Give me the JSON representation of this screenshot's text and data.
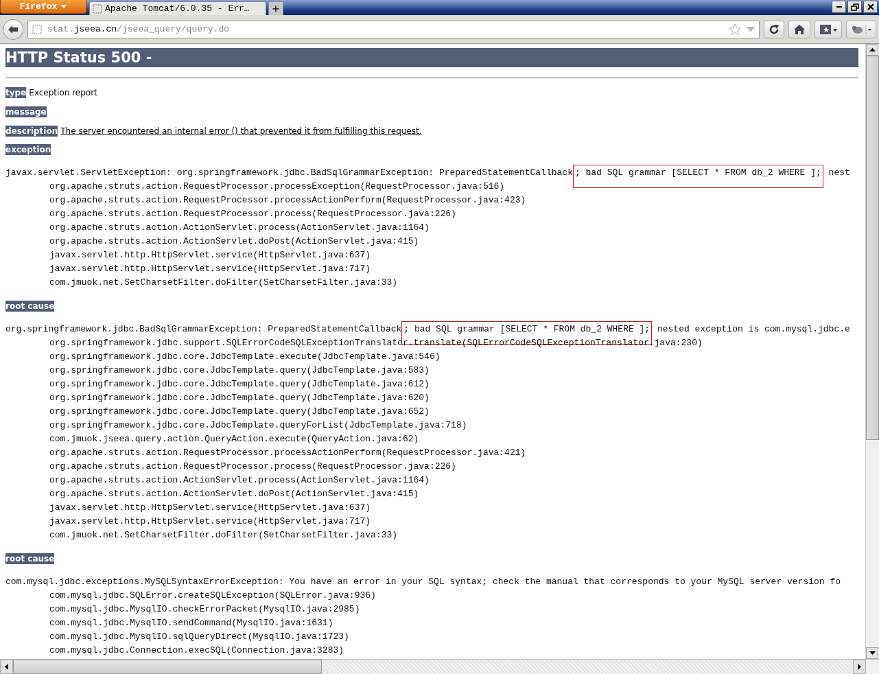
{
  "browser": {
    "menu_button": "Firefox",
    "tabs": [
      {
        "title": "Apache Tomcat/6.0.35 - Err…",
        "selected": true
      }
    ],
    "new_tab": "+",
    "url": {
      "prefix": "stat.",
      "domain": "jseea.cn",
      "path": "/jseea_query/query.do"
    }
  },
  "page": {
    "heading": "HTTP Status 500 -",
    "fields": [
      {
        "label": "type",
        "value": "Exception report",
        "kind": "plain"
      },
      {
        "label": "message"
      },
      {
        "label": "description",
        "value": "The server encountered an internal error () that prevented it from fulfilling this request.",
        "kind": "underlined"
      }
    ],
    "sections": [
      {
        "label": "exception",
        "lines": [
          {
            "kind": "head",
            "segments": [
              {
                "text": "javax.servlet.ServletException: org.springframework.jdbc.BadSqlGrammarException: PreparedStatementCallback",
                "boxed": false
              },
              {
                "text": "; bad SQL grammar [SELECT * FROM db_2 WHERE ];",
                "boxed": true
              },
              {
                "text": " nest",
                "boxed": false
              }
            ]
          },
          {
            "kind": "frame",
            "text": "org.apache.struts.action.RequestProcessor.processException(RequestProcessor.java:516)"
          },
          {
            "kind": "frame",
            "text": "org.apache.struts.action.RequestProcessor.processActionPerform(RequestProcessor.java:423)"
          },
          {
            "kind": "frame",
            "text": "org.apache.struts.action.RequestProcessor.process(RequestProcessor.java:226)"
          },
          {
            "kind": "frame",
            "text": "org.apache.struts.action.ActionServlet.process(ActionServlet.java:1164)"
          },
          {
            "kind": "frame",
            "text": "org.apache.struts.action.ActionServlet.doPost(ActionServlet.java:415)"
          },
          {
            "kind": "frame",
            "text": "javax.servlet.http.HttpServlet.service(HttpServlet.java:637)"
          },
          {
            "kind": "frame",
            "text": "javax.servlet.http.HttpServlet.service(HttpServlet.java:717)"
          },
          {
            "kind": "frame",
            "text": "com.jmuok.net.SetCharsetFilter.doFilter(SetCharsetFilter.java:33)"
          }
        ]
      },
      {
        "label": "root cause",
        "lines": [
          {
            "kind": "head",
            "segments": [
              {
                "text": "org.springframework.jdbc.BadSqlGrammarException: PreparedStatementCallback",
                "boxed": false
              },
              {
                "text": "; bad SQL grammar [SELECT * FROM db_2 WHERE ];",
                "boxed": true
              },
              {
                "text": " nested exception is com.mysql.jdbc.e",
                "boxed": false
              }
            ]
          },
          {
            "kind": "frame",
            "text": "org.springframework.jdbc.support.SQLErrorCodeSQLExceptionTranslator.translate(SQLErrorCodeSQLExceptionTranslator.java:230)"
          },
          {
            "kind": "frame",
            "text": "org.springframework.jdbc.core.JdbcTemplate.execute(JdbcTemplate.java:546)"
          },
          {
            "kind": "frame",
            "text": "org.springframework.jdbc.core.JdbcTemplate.query(JdbcTemplate.java:583)"
          },
          {
            "kind": "frame",
            "text": "org.springframework.jdbc.core.JdbcTemplate.query(JdbcTemplate.java:612)"
          },
          {
            "kind": "frame",
            "text": "org.springframework.jdbc.core.JdbcTemplate.query(JdbcTemplate.java:620)"
          },
          {
            "kind": "frame",
            "text": "org.springframework.jdbc.core.JdbcTemplate.query(JdbcTemplate.java:652)"
          },
          {
            "kind": "frame",
            "text": "org.springframework.jdbc.core.JdbcTemplate.queryForList(JdbcTemplate.java:718)"
          },
          {
            "kind": "frame",
            "text": "com.jmuok.jseea.query.action.QueryAction.execute(QueryAction.java:62)"
          },
          {
            "kind": "frame",
            "text": "org.apache.struts.action.RequestProcessor.processActionPerform(RequestProcessor.java:421)"
          },
          {
            "kind": "frame",
            "text": "org.apache.struts.action.RequestProcessor.process(RequestProcessor.java:226)"
          },
          {
            "kind": "frame",
            "text": "org.apache.struts.action.ActionServlet.process(ActionServlet.java:1164)"
          },
          {
            "kind": "frame",
            "text": "org.apache.struts.action.ActionServlet.doPost(ActionServlet.java:415)"
          },
          {
            "kind": "frame",
            "text": "javax.servlet.http.HttpServlet.service(HttpServlet.java:637)"
          },
          {
            "kind": "frame",
            "text": "javax.servlet.http.HttpServlet.service(HttpServlet.java:717)"
          },
          {
            "kind": "frame",
            "text": "com.jmuok.net.SetCharsetFilter.doFilter(SetCharsetFilter.java:33)"
          }
        ]
      },
      {
        "label": "root cause",
        "lines": [
          {
            "kind": "head",
            "text": "com.mysql.jdbc.exceptions.MySQLSyntaxErrorException: You have an error in your SQL syntax; check the manual that corresponds to your MySQL server version fo"
          },
          {
            "kind": "frame",
            "text": "com.mysql.jdbc.SQLError.createSQLException(SQLError.java:936)"
          },
          {
            "kind": "frame",
            "text": "com.mysql.jdbc.MysqlIO.checkErrorPacket(MysqlIO.java:2985)"
          },
          {
            "kind": "frame",
            "text": "com.mysql.jdbc.MysqlIO.sendCommand(MysqlIO.java:1631)"
          },
          {
            "kind": "frame",
            "text": "com.mysql.jdbc.MysqlIO.sqlQueryDirect(MysqlIO.java:1723)"
          },
          {
            "kind": "frame",
            "text": "com.mysql.jdbc.Connection.execSQL(Connection.java:3283)"
          }
        ]
      }
    ]
  }
}
